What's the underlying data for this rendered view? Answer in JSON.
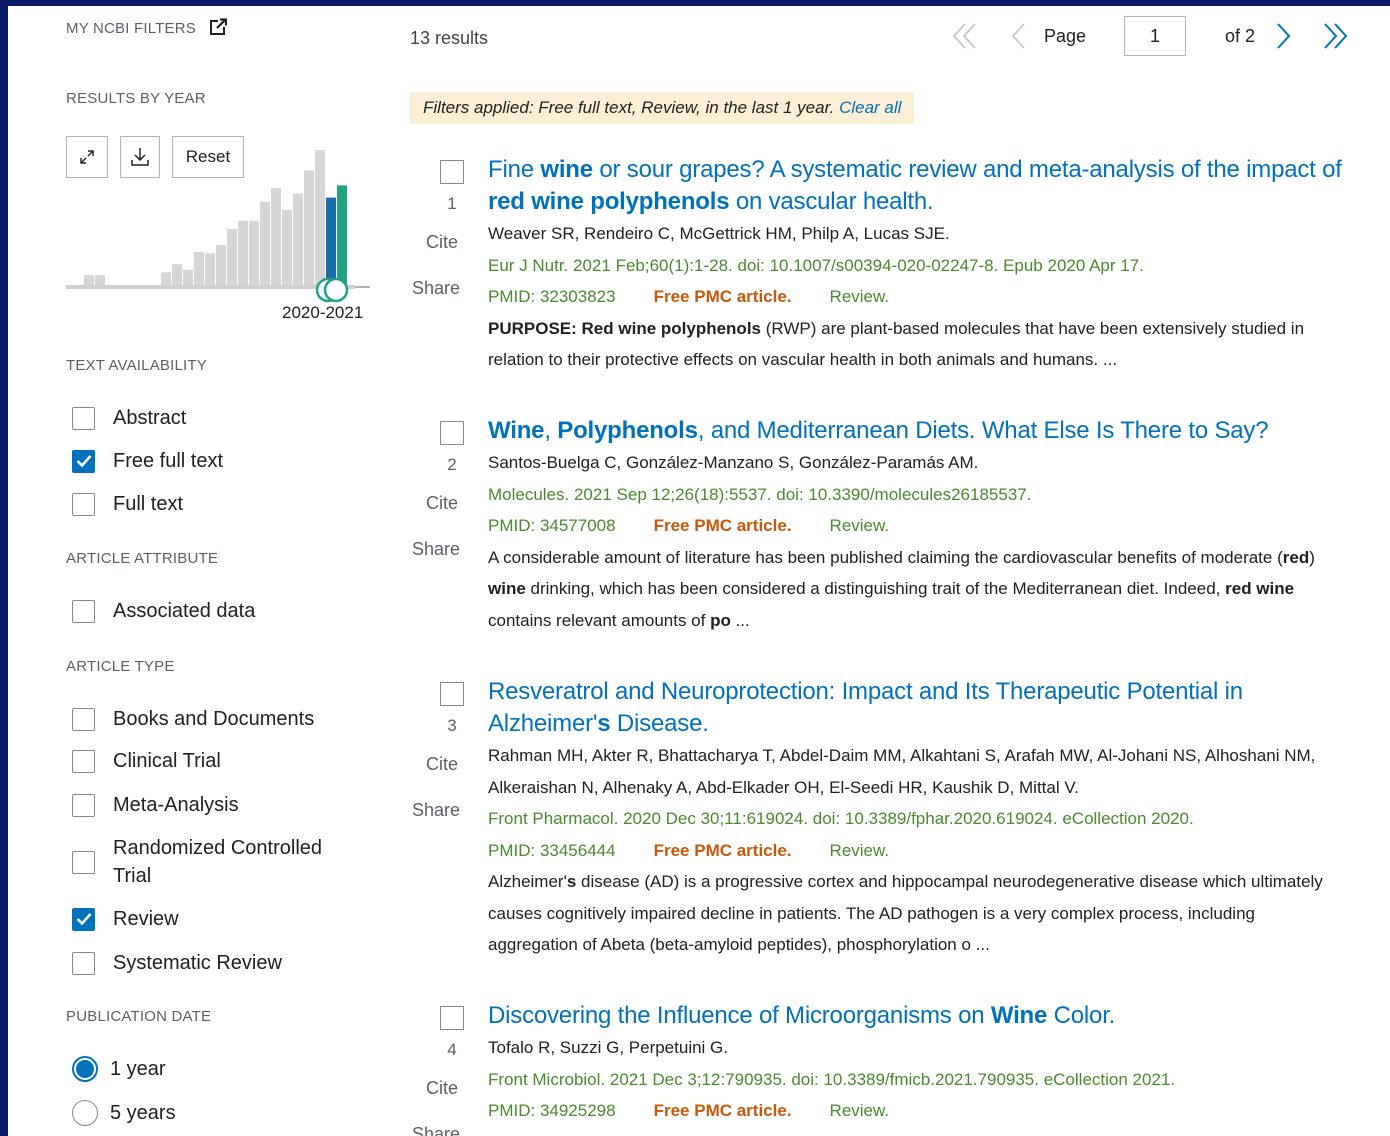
{
  "sidebar": {
    "my_ncbi_filters": "MY NCBI FILTERS",
    "results_by_year": "RESULTS BY YEAR",
    "reset_label": "Reset",
    "year_range": "2020-2021",
    "text_availability": {
      "heading": "TEXT AVAILABILITY",
      "items": [
        {
          "label": "Abstract",
          "checked": false
        },
        {
          "label": "Free full text",
          "checked": true
        },
        {
          "label": "Full text",
          "checked": false
        }
      ]
    },
    "article_attribute": {
      "heading": "ARTICLE ATTRIBUTE",
      "items": [
        {
          "label": "Associated data",
          "checked": false
        }
      ]
    },
    "article_type": {
      "heading": "ARTICLE TYPE",
      "items": [
        {
          "label": "Books and Documents",
          "checked": false
        },
        {
          "label": "Clinical Trial",
          "checked": false
        },
        {
          "label": "Meta-Analysis",
          "checked": false
        },
        {
          "label": "Randomized Controlled",
          "label2": "Trial",
          "checked": false
        },
        {
          "label": "Review",
          "checked": true
        },
        {
          "label": "Systematic Review",
          "checked": false
        }
      ]
    },
    "publication_date": {
      "heading": "PUBLICATION DATE",
      "options": [
        {
          "label": "1 year",
          "selected": true
        },
        {
          "label": "5 years",
          "selected": false
        }
      ]
    },
    "year_histogram": {
      "bars": [
        0.08,
        0.08,
        0,
        0,
        0,
        0,
        0,
        0.1,
        0.16,
        0.12,
        0.25,
        0.24,
        0.3,
        0.42,
        0.48,
        0.48,
        0.62,
        0.72,
        0.56,
        0.68,
        0.85,
        1.0,
        0.65,
        0.74
      ],
      "highlight_index": 22,
      "bar_color": "#d6d6d6",
      "highlight_color": "#1a6ea8",
      "selected_color": "#20a37e"
    }
  },
  "toolbar": {
    "results_count": "13 results",
    "page_label": "Page",
    "page_value": "1",
    "of_label": "of 2"
  },
  "filters_applied": {
    "text": "Filters applied: Free full text, Review, in the last 1 year.",
    "clear_label": "Clear all"
  },
  "results": [
    {
      "num": "1",
      "title_parts": [
        {
          "t": "Fine ",
          "b": false
        },
        {
          "t": "wine",
          "b": true
        },
        {
          "t": " or sour grapes? A systematic review and meta-analysis of the impact of ",
          "b": false
        },
        {
          "t": "red wine polyphenols",
          "b": true
        },
        {
          "t": " on vascular health.",
          "b": false
        }
      ],
      "authors": "Weaver SR, Rendeiro C, McGettrick HM, Philp A, Lucas SJE.",
      "journal": "Eur J Nutr. 2021 Feb;60(1):1-28. doi: 10.1007/s00394-020-02247-8. Epub 2020 Apr 17.",
      "pmid": "PMID: 32303823",
      "pmc": "Free PMC article.",
      "review": "Review.",
      "snippet_parts": [
        {
          "t": "PURPOSE: ",
          "b": true
        },
        {
          "t": "Red wine polyphenols",
          "b": true
        },
        {
          "t": " (RWP) are plant-based molecules that have been extensively studied in relation to their protective effects on vascular health in both animals and humans. ...",
          "b": false
        }
      ]
    },
    {
      "num": "2",
      "title_parts": [
        {
          "t": "Wine",
          "b": true
        },
        {
          "t": ", ",
          "b": false
        },
        {
          "t": "Polyphenols",
          "b": true
        },
        {
          "t": ", and Mediterranean Diets. What Else Is There to Say?",
          "b": false
        }
      ],
      "authors": "Santos-Buelga C, González-Manzano S, González-Paramás AM.",
      "journal": "Molecules. 2021 Sep 12;26(18):5537. doi: 10.3390/molecules26185537.",
      "pmid": "PMID: 34577008",
      "pmc": "Free PMC article.",
      "review": "Review.",
      "snippet_parts": [
        {
          "t": "A considerable amount of literature has been published claiming the cardiovascular benefits of moderate (",
          "b": false
        },
        {
          "t": "red",
          "b": true
        },
        {
          "t": ") ",
          "b": false
        },
        {
          "t": "wine",
          "b": true
        },
        {
          "t": " drinking, which has been considered a distinguishing trait of the Mediterranean diet. Indeed, ",
          "b": false
        },
        {
          "t": "red wine",
          "b": true
        },
        {
          "t": " contains relevant amounts of ",
          "b": false
        },
        {
          "t": "po",
          "b": true
        },
        {
          "t": " ...",
          "b": false
        }
      ]
    },
    {
      "num": "3",
      "title_parts": [
        {
          "t": "Resveratrol and Neuroprotection: Impact and Its Therapeutic Potential in Alzheimer'",
          "b": false
        },
        {
          "t": "s",
          "b": true
        },
        {
          "t": " Disease.",
          "b": false
        }
      ],
      "authors": "Rahman MH, Akter R, Bhattacharya T, Abdel-Daim MM, Alkahtani S, Arafah MW, Al-Johani NS, Alhoshani NM, Alkeraishan N, Alhenaky A, Abd-Elkader OH, El-Seedi HR, Kaushik D, Mittal V.",
      "journal": "Front Pharmacol. 2020 Dec 30;11:619024. doi: 10.3389/fphar.2020.619024. eCollection 2020.",
      "pmid": "PMID: 33456444",
      "pmc": "Free PMC article.",
      "review": "Review.",
      "snippet_parts": [
        {
          "t": "Alzheimer'",
          "b": false
        },
        {
          "t": "s",
          "b": true
        },
        {
          "t": " disease (AD) is a progressive cortex and hippocampal neurodegenerative disease which ultimately causes cognitively impaired decline in patients. The AD pathogen is a very complex process, including aggregation of Abeta (beta-amyloid peptides), phosphorylation o ...",
          "b": false
        }
      ]
    },
    {
      "num": "4",
      "title_parts": [
        {
          "t": "Discovering the Influence of Microorganisms on ",
          "b": false
        },
        {
          "t": "Wine",
          "b": true
        },
        {
          "t": " Color.",
          "b": false
        }
      ],
      "authors": "Tofalo R, Suzzi G, Perpetuini G.",
      "journal": "Front Microbiol. 2021 Dec 3;12:790935. doi: 10.3389/fmicb.2021.790935. eCollection 2021.",
      "pmid": "PMID: 34925298",
      "pmc": "Free PMC article.",
      "review": "Review.",
      "snippet_parts": []
    }
  ],
  "result_labels": {
    "cite": "Cite",
    "share": "Share"
  }
}
